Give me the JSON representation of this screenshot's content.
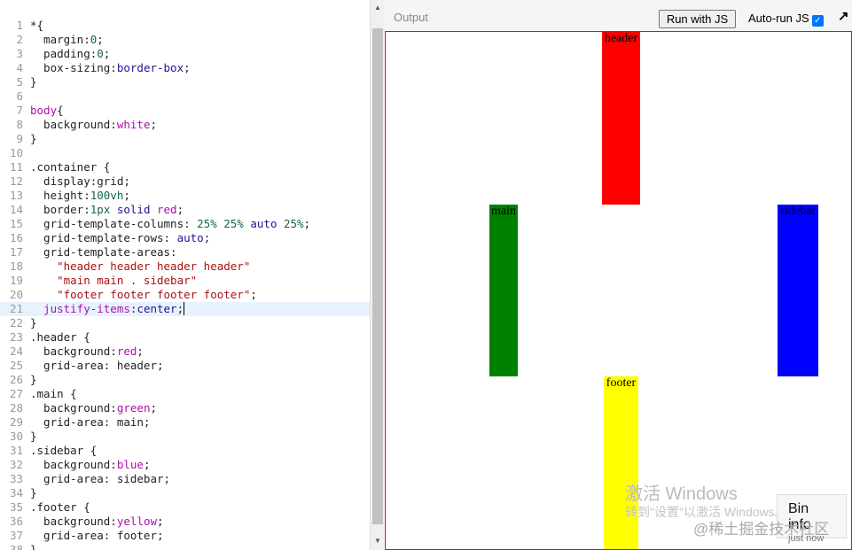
{
  "editor": {
    "active_line": 21,
    "lines": [
      [
        [
          "",
          "*{"
        ]
      ],
      [
        [
          "",
          "  margin:"
        ],
        [
          "num",
          "0"
        ],
        [
          "",
          ";"
        ]
      ],
      [
        [
          "",
          "  padding:"
        ],
        [
          "num",
          "0"
        ],
        [
          "",
          ";"
        ]
      ],
      [
        [
          "",
          "  box-sizing:"
        ],
        [
          "kw",
          "border-box"
        ],
        [
          "",
          ";"
        ]
      ],
      [
        [
          "",
          "}"
        ]
      ],
      [],
      [
        [
          "tag",
          "body"
        ],
        [
          "",
          "{"
        ]
      ],
      [
        [
          "",
          "  background:"
        ],
        [
          "col",
          "white"
        ],
        [
          "",
          ";"
        ]
      ],
      [
        [
          "",
          "}"
        ]
      ],
      [],
      [
        [
          "",
          ".container {"
        ]
      ],
      [
        [
          "",
          "  display:grid;"
        ]
      ],
      [
        [
          "",
          "  height:"
        ],
        [
          "num",
          "100vh"
        ],
        [
          "",
          ";"
        ]
      ],
      [
        [
          "",
          "  border:"
        ],
        [
          "num",
          "1px"
        ],
        [
          "kw",
          " solid"
        ],
        [
          "col",
          " red"
        ],
        [
          "",
          ";"
        ]
      ],
      [
        [
          "",
          "  grid-template-columns: "
        ],
        [
          "num",
          "25% 25%"
        ],
        [
          "kw",
          " auto"
        ],
        [
          "num",
          " 25%"
        ],
        [
          "",
          ";"
        ]
      ],
      [
        [
          "",
          "  grid-template-rows: "
        ],
        [
          "kw",
          "auto"
        ],
        [
          "",
          ";"
        ]
      ],
      [
        [
          "",
          "  grid-template-areas:"
        ]
      ],
      [
        [
          "str",
          "    \"header header header header\""
        ]
      ],
      [
        [
          "str",
          "    \"main main . sidebar\""
        ]
      ],
      [
        [
          "str",
          "    \"footer footer footer footer\""
        ],
        [
          "",
          ";"
        ]
      ],
      [
        [
          "col",
          "  justify-items"
        ],
        [
          "",
          ":"
        ],
        [
          "kw",
          "center"
        ],
        [
          "",
          ";"
        ]
      ],
      [
        [
          "",
          "}"
        ]
      ],
      [
        [
          "",
          ".header {"
        ]
      ],
      [
        [
          "",
          "  background:"
        ],
        [
          "col",
          "red"
        ],
        [
          "",
          ";"
        ]
      ],
      [
        [
          "",
          "  grid-area: header;"
        ]
      ],
      [
        [
          "",
          "}"
        ]
      ],
      [
        [
          "",
          ".main {"
        ]
      ],
      [
        [
          "",
          "  background:"
        ],
        [
          "col",
          "green"
        ],
        [
          "",
          ";"
        ]
      ],
      [
        [
          "",
          "  grid-area: main;"
        ]
      ],
      [
        [
          "",
          "}"
        ]
      ],
      [
        [
          "",
          ".sidebar {"
        ]
      ],
      [
        [
          "",
          "  background:"
        ],
        [
          "col",
          "blue"
        ],
        [
          "",
          ";"
        ]
      ],
      [
        [
          "",
          "  grid-area: sidebar;"
        ]
      ],
      [
        [
          "",
          "}"
        ]
      ],
      [
        [
          "",
          ".footer {"
        ]
      ],
      [
        [
          "",
          "  background:"
        ],
        [
          "col",
          "yellow"
        ],
        [
          "",
          ";"
        ]
      ],
      [
        [
          "",
          "  grid-area: footer;"
        ]
      ],
      [
        [
          "",
          "}"
        ]
      ]
    ]
  },
  "output": {
    "label": "Output",
    "run_button": "Run with JS",
    "autorun_label": "Auto-run JS",
    "autorun_checked": true,
    "open_icon": "↗",
    "boxes": {
      "header": "header",
      "main": "main",
      "sidebar": "sidebar",
      "footer": "footer"
    },
    "colors": {
      "header": "#ff0000",
      "main": "#008000",
      "sidebar": "#0000ff",
      "footer": "#ffff00"
    }
  },
  "watermark": {
    "line1": "激活 Windows",
    "line2": "转到\"设置\"以激活 Windows。",
    "credit": "@稀土掘金技术社区"
  },
  "bin_info": {
    "title": "Bin info",
    "sub": "just now"
  }
}
